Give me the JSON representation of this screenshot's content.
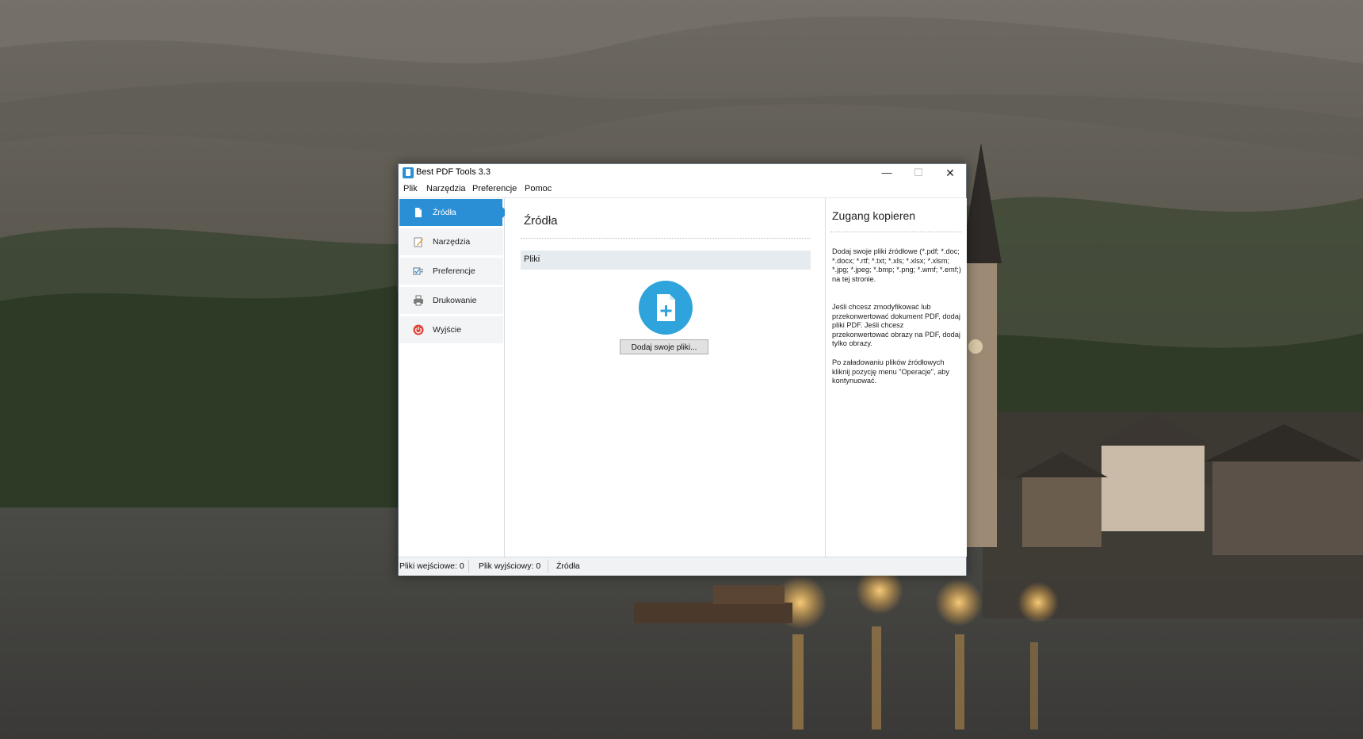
{
  "window": {
    "title": "Best PDF Tools 3.3",
    "controls": {
      "minimize": "—",
      "maximize": "☐",
      "close": "✕"
    }
  },
  "menu": [
    "Plik",
    "Narzędzia",
    "Preferencje",
    "Pomoc"
  ],
  "sidebar": {
    "items": [
      {
        "label": "Źródła",
        "icon": "document-icon",
        "active": true
      },
      {
        "label": "Narzędzia",
        "icon": "edit-icon",
        "active": false
      },
      {
        "label": "Preferencje",
        "icon": "checkbox-icon",
        "active": false
      },
      {
        "label": "Drukowanie",
        "icon": "printer-icon",
        "active": false
      },
      {
        "label": "Wyjście",
        "icon": "power-icon",
        "active": false
      }
    ]
  },
  "main": {
    "title": "Źródła",
    "section_label": "Pliki",
    "add_files_button": "Dodaj swoje pliki..."
  },
  "help": {
    "title": "Zugang kopieren",
    "paragraphs": [
      "Dodaj swoje pliki źródłowe (*.pdf; *.doc; *.docx; *.rtf; *.txt; *.xls; *.xlsx; *.xlsm; *.jpg; *.jpeg; *.bmp; *.png; *.wmf; *.emf;) na tej stronie.",
      "Jeśli chcesz zmodyfikować lub przekonwertować dokument PDF, dodaj pliki PDF. Jeśli chcesz przekonwertować obrazy na PDF, dodaj tylko obrazy.",
      "Po załadowaniu plików źródłowych kliknij pozycję menu \"Operacje\", aby kontynuować."
    ]
  },
  "status": {
    "input_files": "Pliki wejściowe: 0",
    "output_files": "Plik wyjściowy: 0",
    "current_page": "Źródła"
  },
  "colors": {
    "accent": "#2b8fd6",
    "add_circle": "#2fa3dc",
    "section_bar": "#e6ebf0",
    "power_icon": "#e0463a"
  }
}
